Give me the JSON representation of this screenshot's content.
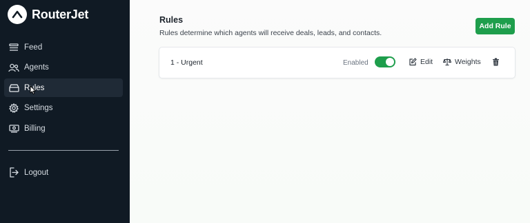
{
  "brand": {
    "name": "RouterJet"
  },
  "sidebar": {
    "items": [
      {
        "label": "Feed",
        "icon": "feed-icon"
      },
      {
        "label": "Agents",
        "icon": "agents-icon"
      },
      {
        "label": "Rules",
        "icon": "rules-icon",
        "active": true
      },
      {
        "label": "Settings",
        "icon": "settings-icon"
      },
      {
        "label": "Billing",
        "icon": "billing-icon"
      }
    ],
    "logout": {
      "label": "Logout",
      "icon": "logout-icon"
    }
  },
  "main": {
    "title": "Rules",
    "subtitle": "Rules determine which agents will receive deals, leads, and contacts.",
    "add_button": "Add Rule",
    "rules": [
      {
        "name": "1 - Urgent",
        "status_label": "Enabled",
        "enabled": true,
        "edit_label": "Edit",
        "weights_label": "Weights"
      }
    ]
  },
  "colors": {
    "sidebar_bg": "#101a24",
    "accent_green": "#1e9e4c",
    "active_item_bg": "#1f2a36"
  }
}
